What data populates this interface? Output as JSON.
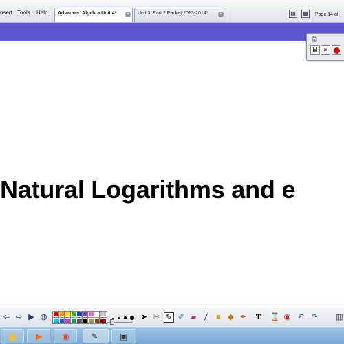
{
  "menu": [
    {
      "label": "nsert",
      "id": "insert"
    },
    {
      "label": "Tools",
      "id": "tools"
    },
    {
      "label": "Help",
      "id": "help"
    }
  ],
  "tabs": [
    {
      "label": "Advanced Algebra Unit 4*",
      "active": true
    },
    {
      "label": "Unit 3, Part 2 Packet 2013-2014*",
      "active": false
    }
  ],
  "page_indicator": "Page 14 of",
  "floating_toolbar": {
    "buttons": [
      {
        "label": "M",
        "id": "minimize"
      },
      {
        "label": "×",
        "id": "close"
      }
    ],
    "record_icon": "record-icon"
  },
  "slide": {
    "title": "Natural Logarithms and e"
  },
  "palette": [
    "#e00000",
    "#ff8c00",
    "#ffd800",
    "#2bb300",
    "#0050d0",
    "#7a3ad0",
    "#ff66cc",
    "#ffffff",
    "#c0c0c0",
    "#00c8ff",
    "#1b4fff",
    "#c040c0",
    "#00a050",
    "#505050",
    "#000000",
    "#b38b5a",
    "#804000",
    "#a00000"
  ],
  "colors": {
    "purple_band": "#5b54cf",
    "record_red": "#e00000",
    "taskbar": "#8bb6dd"
  },
  "bottom_icons": [
    "page-prev-icon",
    "page-next-icon",
    "play-icon",
    "globe-icon",
    "select-arrow-icon",
    "tools-icon",
    "pen-icon",
    "highlighter-icon",
    "eraser-icon",
    "line-icon",
    "shapes-icon",
    "fill-icon",
    "text-icon",
    "clear-icon",
    "record-screen-icon",
    "undo-icon",
    "redo-icon"
  ],
  "taskbar": {
    "apps": [
      "start-orb",
      "explorer-icon",
      "media-player-icon",
      "chrome-icon",
      "smart-notebook-icon",
      "recorder-icon"
    ]
  }
}
